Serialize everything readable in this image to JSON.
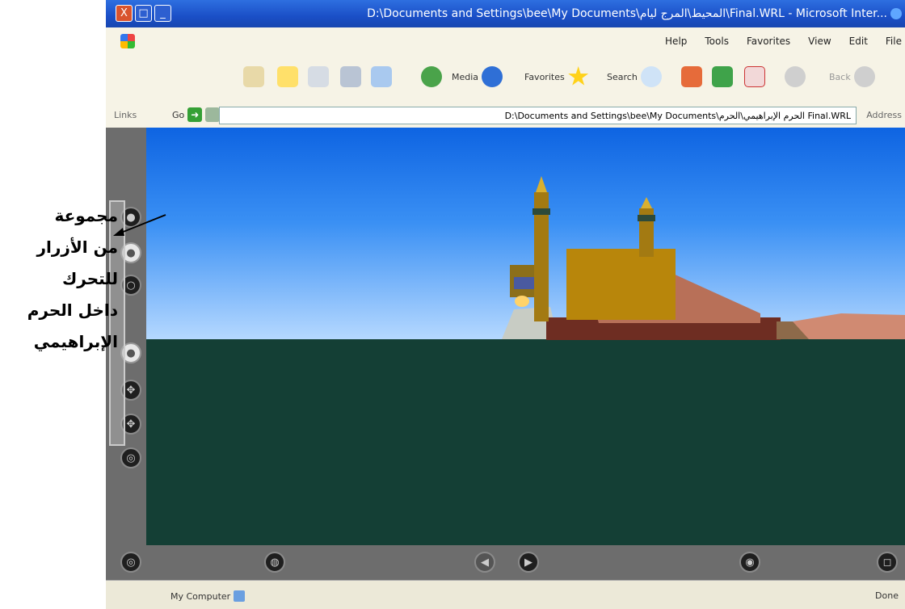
{
  "window": {
    "title": "‏D:\\Documents and Settings\\bee\\My Documents\\المحيط\\المرج ليام\\Final.WRL - Microsoft Inter...",
    "controls": {
      "close": "X",
      "maximize": "□",
      "minimize": "_"
    }
  },
  "menu": [
    "File",
    "Edit",
    "View",
    "Favorites",
    "Tools",
    "Help"
  ],
  "toolbar": {
    "back": "Back",
    "search": "Search",
    "favorites": "Favorites",
    "media": "Media"
  },
  "address": {
    "label": "Address",
    "value": "D:\\Documents and Settings\\bee\\My Documents\\الحرم الإبراهيمي\\الحرم Final.WRL",
    "go": "Go",
    "links": "Links"
  },
  "status": {
    "done": "Done",
    "zone": "My Computer"
  },
  "annotation": {
    "lines": [
      "مجموعة",
      "من الأزرار",
      "للتحرك",
      "داخل الحرم",
      "الإبراهيمي"
    ]
  },
  "colors": {
    "titlebar": "#2e6fe0",
    "sky_top": "#0e64e2",
    "ground": "#143f35",
    "viewer_frame": "#6d6d6d"
  }
}
